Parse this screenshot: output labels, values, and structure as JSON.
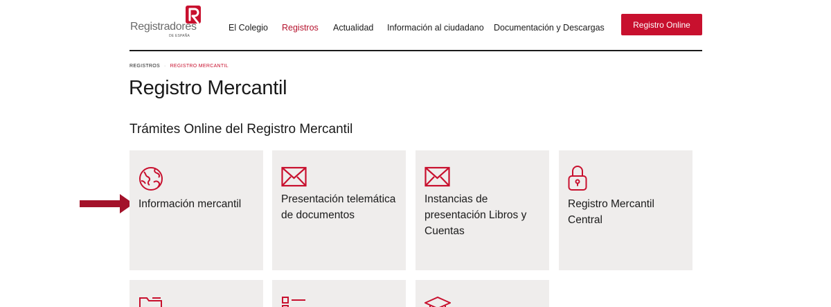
{
  "logo": {
    "text": "Registradores",
    "subtext": "DE ESPAÑA",
    "mark_color": "#c8102e"
  },
  "nav": {
    "items": [
      {
        "label": "El Colegio",
        "active": false
      },
      {
        "label": "Registros",
        "active": true
      },
      {
        "label": "Actualidad",
        "active": false
      },
      {
        "label": "Información al ciudadano",
        "active": false
      },
      {
        "label": "Documentación y Descargas",
        "active": false
      }
    ],
    "cta_label": "Registro Online"
  },
  "breadcrumb": {
    "items": [
      "REGISTROS",
      "REGISTRO MERCANTIL"
    ],
    "separator": "·"
  },
  "page_title": "Registro Mercantil",
  "section_title": "Trámites Online del Registro Mercantil",
  "cards": [
    {
      "icon": "globe-icon",
      "label": "Información mercantil"
    },
    {
      "icon": "envelope-icon",
      "label": "Presentación telemática de documentos"
    },
    {
      "icon": "envelope-icon",
      "label": "Instancias de presentación Libros y Cuentas"
    },
    {
      "icon": "lock-icon",
      "label": "Registro Mercantil Central"
    }
  ],
  "cards_row2": [
    {
      "icon": "folder-icon"
    },
    {
      "icon": "checklist-icon"
    },
    {
      "icon": "graduation-cap-icon"
    }
  ],
  "colors": {
    "accent": "#c8102e",
    "card_bg": "#efedec",
    "arrow": "#a3122a"
  }
}
